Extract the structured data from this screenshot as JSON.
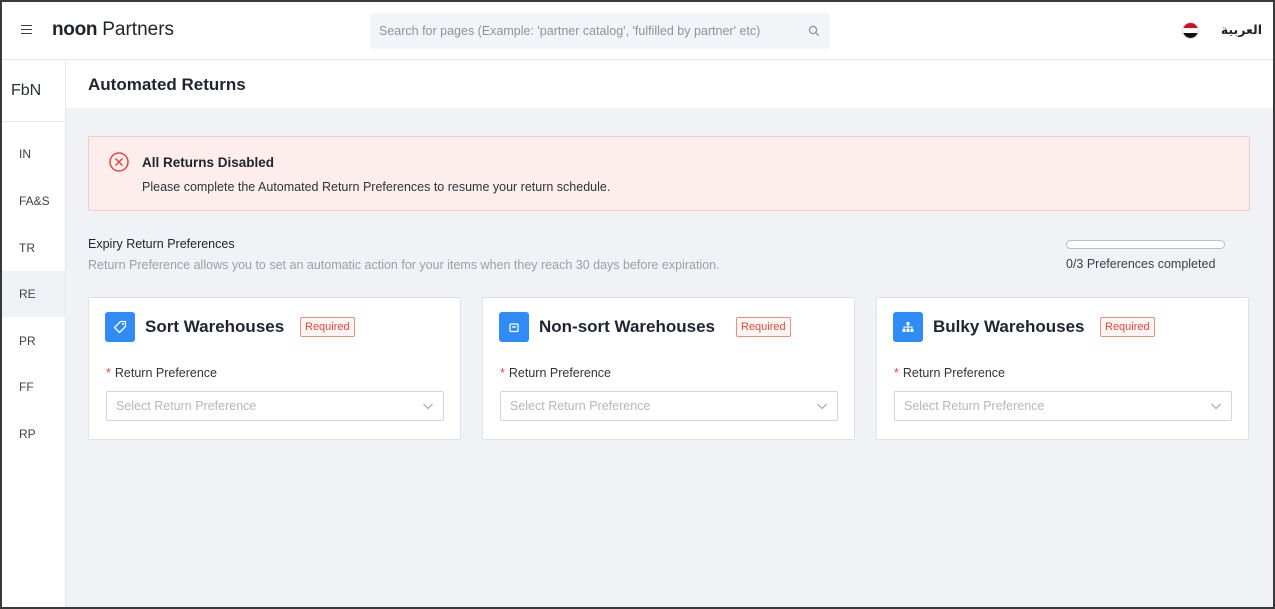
{
  "header": {
    "menu_icon": "hamburger-icon",
    "logo_bold": "noon",
    "logo_light": "Partners",
    "search_placeholder": "Search for pages (Example: 'partner catalog', 'fulfilled by partner' etc)",
    "search_icon": "search-icon",
    "flag_icon": "egypt-flag-icon",
    "language_label": "العربية"
  },
  "sidebar": {
    "brand": "FbN",
    "items": [
      {
        "label": "IN",
        "active": false
      },
      {
        "label": "FA&S",
        "active": false
      },
      {
        "label": "TR",
        "active": false
      },
      {
        "label": "RE",
        "active": true
      },
      {
        "label": "PR",
        "active": false
      },
      {
        "label": "FF",
        "active": false
      },
      {
        "label": "RP",
        "active": false
      }
    ]
  },
  "page": {
    "title": "Automated Returns"
  },
  "alert": {
    "icon": "error-circle-icon",
    "title": "All Returns Disabled",
    "message": "Please complete the Automated Return Preferences to resume your return schedule."
  },
  "preferences": {
    "title": "Expiry Return Preferences",
    "description": "Return Preference allows you to set an automatic action for your items when they reach 30 days before expiration.",
    "progress_fraction": 0,
    "progress_label": "0/3 Preferences completed"
  },
  "cards": [
    {
      "icon": "tag-icon",
      "title": "Sort Warehouses",
      "badge": "Required",
      "field_label": "Return Preference",
      "placeholder": "Select Return Preference"
    },
    {
      "icon": "box-icon",
      "title": "Non-sort Warehouses",
      "badge": "Required",
      "field_label": "Return Preference",
      "placeholder": "Select Return Preference"
    },
    {
      "icon": "hierarchy-icon",
      "title": "Bulky Warehouses",
      "badge": "Required",
      "field_label": "Return Preference",
      "placeholder": "Select Return Preference"
    }
  ],
  "colors": {
    "accent": "#2f8cf6",
    "alert_background": "#fdeeed",
    "required_red": "#e0483c"
  }
}
